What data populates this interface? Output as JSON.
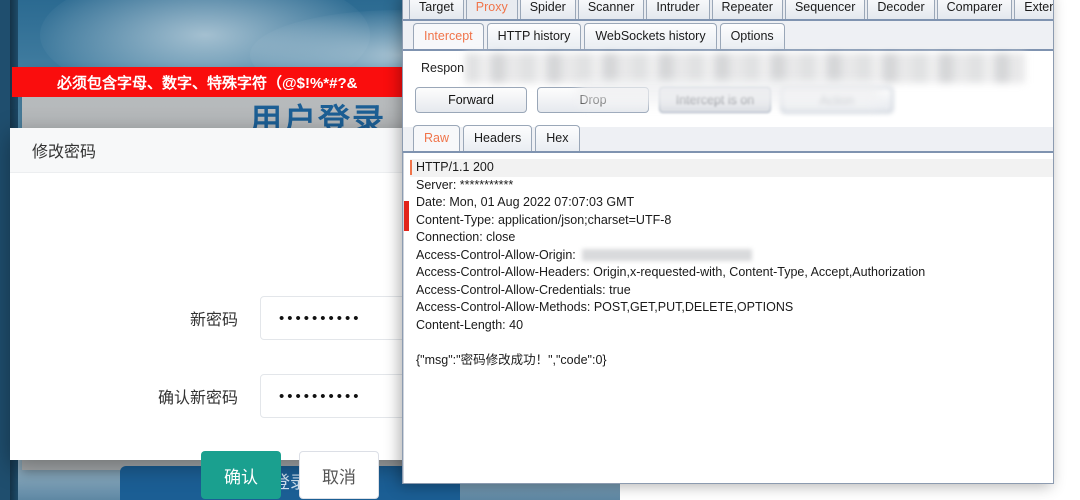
{
  "webpage": {
    "login_card_title": "用户登录",
    "login_submit_label": "登录",
    "modal": {
      "title": "修改密码",
      "alert": "必须包含字母、数字、特殊字符（@$!%*#?&",
      "fields": [
        {
          "label": "新密码",
          "value": "••••••••••",
          "name": "new-password"
        },
        {
          "label": "确认新密码",
          "value": "••••••••••",
          "name": "confirm-password"
        }
      ],
      "confirm_label": "确认",
      "cancel_label": "取消"
    }
  },
  "burp": {
    "main_tabs": [
      {
        "label": "Target",
        "active": false
      },
      {
        "label": "Proxy",
        "active": true
      },
      {
        "label": "Spider",
        "active": false
      },
      {
        "label": "Scanner",
        "active": false
      },
      {
        "label": "Intruder",
        "active": false
      },
      {
        "label": "Repeater",
        "active": false
      },
      {
        "label": "Sequencer",
        "active": false
      },
      {
        "label": "Decoder",
        "active": false
      },
      {
        "label": "Comparer",
        "active": false
      },
      {
        "label": "Extender",
        "active": false
      }
    ],
    "sub_tabs": [
      {
        "label": "Intercept",
        "active": true
      },
      {
        "label": "HTTP history",
        "active": false
      },
      {
        "label": "WebSockets history",
        "active": false
      },
      {
        "label": "Options",
        "active": false
      }
    ],
    "response_label": "Respon",
    "buttons": [
      {
        "label": "Forward",
        "state": "normal"
      },
      {
        "label": "Drop",
        "state": "normal"
      },
      {
        "label": "Intercept is on",
        "state": "dim"
      },
      {
        "label": "Action",
        "state": "blurred"
      }
    ],
    "message_tabs": [
      {
        "label": "Raw",
        "active": true
      },
      {
        "label": "Headers",
        "active": false
      },
      {
        "label": "Hex",
        "active": false
      }
    ],
    "response": {
      "status_line": "HTTP/1.1 200",
      "headers": [
        "Server: ***********",
        "Date: Mon, 01 Aug 2022 07:07:03 GMT",
        "Content-Type: application/json;charset=UTF-8",
        "Connection: close"
      ],
      "origin_header_label": "Access-Control-Allow-Origin: ",
      "headers_after_origin": [
        "Access-Control-Allow-Headers: Origin,x-requested-with, Content-Type, Accept,Authorization",
        "Access-Control-Allow-Credentials: true",
        "Access-Control-Allow-Methods: POST,GET,PUT,DELETE,OPTIONS",
        "Content-Length: 40"
      ],
      "body": "{\"msg\":\"密码修改成功！\",\"code\":0}"
    }
  },
  "colors": {
    "accent_orange": "#f0744a",
    "alert_red": "#fa0d0d",
    "confirm_teal": "#1aa08f",
    "login_blue": "#1b5e94"
  }
}
